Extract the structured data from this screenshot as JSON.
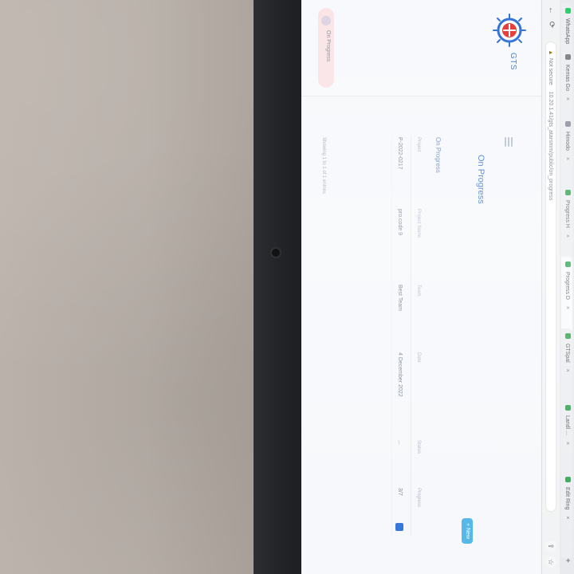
{
  "browser": {
    "tabs": [
      {
        "label": "WhatsApp"
      },
      {
        "label": "Kemas Go"
      },
      {
        "label": "Himodo"
      },
      {
        "label": "Progress H"
      },
      {
        "label": "Progress D"
      },
      {
        "label": "GTSpal"
      },
      {
        "label": "Landl ..."
      },
      {
        "label": "Edit Ring"
      }
    ],
    "address": {
      "security_label": "Not secure",
      "url": "10.20.1.41/gts_atarsmm/public/on_progress"
    }
  },
  "app": {
    "brand": "GTS",
    "page_title": "On Progress",
    "section_title": "On Progress",
    "nav_active_label": "On Progress",
    "primary_action_label": "+ New",
    "table": {
      "columns": [
        "Project",
        "Project Name",
        "Team",
        "Date",
        "Status",
        "Progress"
      ],
      "rows": [
        {
          "project": "P-2022-0217",
          "name": "pro.code 9",
          "team": "Best Team",
          "date": "4 December 2022",
          "status": "...",
          "progress": "3/7"
        }
      ]
    },
    "footer_note": "Showing 1 to 1 of 1 entries"
  }
}
